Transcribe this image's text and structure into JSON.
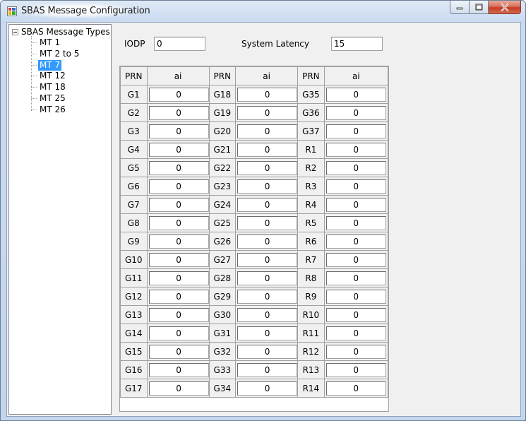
{
  "window": {
    "title": "SBAS Message Configuration"
  },
  "tree": {
    "root": "SBAS Message Types",
    "items": [
      "MT 1",
      "MT 2 to 5",
      "MT 7",
      "MT 12",
      "MT 18",
      "MT 25",
      "MT 26"
    ],
    "selected_index": 2
  },
  "fields": {
    "iodp_label": "IODP",
    "iodp_value": "0",
    "latency_label": "System Latency",
    "latency_value": "15"
  },
  "grid": {
    "headers": [
      "PRN",
      "ai",
      "PRN",
      "ai",
      "PRN",
      "ai"
    ],
    "rows": [
      [
        "G1",
        "0",
        "G18",
        "0",
        "G35",
        "0"
      ],
      [
        "G2",
        "0",
        "G19",
        "0",
        "G36",
        "0"
      ],
      [
        "G3",
        "0",
        "G20",
        "0",
        "G37",
        "0"
      ],
      [
        "G4",
        "0",
        "G21",
        "0",
        "R1",
        "0"
      ],
      [
        "G5",
        "0",
        "G22",
        "0",
        "R2",
        "0"
      ],
      [
        "G6",
        "0",
        "G23",
        "0",
        "R3",
        "0"
      ],
      [
        "G7",
        "0",
        "G24",
        "0",
        "R4",
        "0"
      ],
      [
        "G8",
        "0",
        "G25",
        "0",
        "R5",
        "0"
      ],
      [
        "G9",
        "0",
        "G26",
        "0",
        "R6",
        "0"
      ],
      [
        "G10",
        "0",
        "G27",
        "0",
        "R7",
        "0"
      ],
      [
        "G11",
        "0",
        "G28",
        "0",
        "R8",
        "0"
      ],
      [
        "G12",
        "0",
        "G29",
        "0",
        "R9",
        "0"
      ],
      [
        "G13",
        "0",
        "G30",
        "0",
        "R10",
        "0"
      ],
      [
        "G14",
        "0",
        "G31",
        "0",
        "R11",
        "0"
      ],
      [
        "G15",
        "0",
        "G32",
        "0",
        "R12",
        "0"
      ],
      [
        "G16",
        "0",
        "G33",
        "0",
        "R13",
        "0"
      ],
      [
        "G17",
        "0",
        "G34",
        "0",
        "R14",
        "0"
      ]
    ]
  },
  "colors": {
    "selection": "#3399ff",
    "close_button": "#c43c23"
  },
  "icons": {
    "app": "app-icon",
    "minimize": "minimize-icon",
    "maximize": "maximize-icon",
    "close": "close-icon",
    "tree_expander": "collapse-icon"
  }
}
